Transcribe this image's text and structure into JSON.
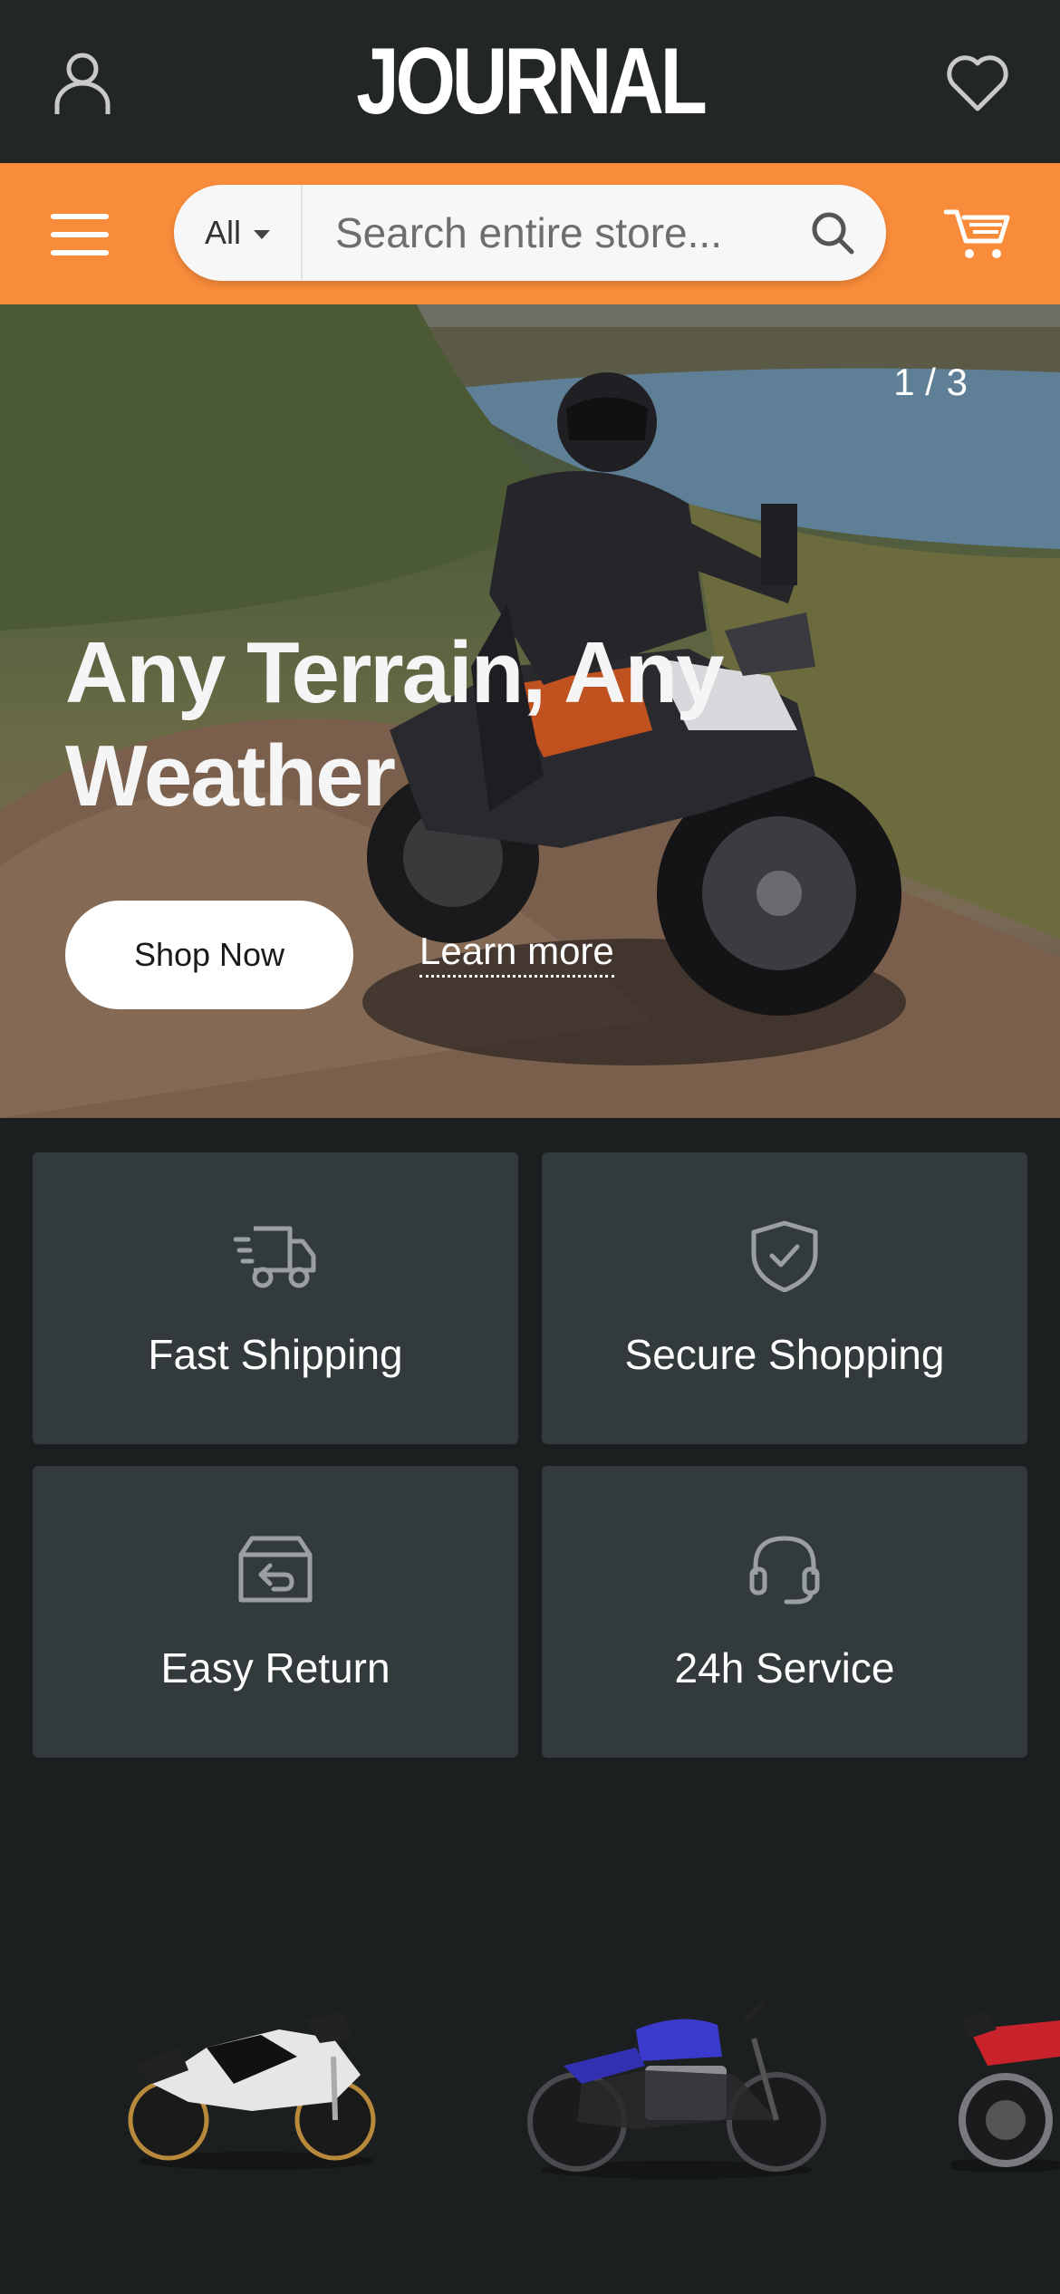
{
  "header": {
    "logo": "JOURNAL",
    "account_icon": "user-icon",
    "wishlist_icon": "heart-icon"
  },
  "search": {
    "category": "All",
    "placeholder": "Search entire store...",
    "menu_icon": "hamburger-icon",
    "search_icon": "search-icon",
    "cart_icon": "cart-icon"
  },
  "hero": {
    "counter": "1 / 3",
    "title": "Any Terrain, Any Weather",
    "primary_cta": "Shop Now",
    "secondary_cta": "Learn more"
  },
  "features": [
    {
      "label": "Fast Shipping",
      "icon": "truck-icon"
    },
    {
      "label": "Secure Shopping",
      "icon": "shield-check-icon"
    },
    {
      "label": "Easy Return",
      "icon": "return-box-icon"
    },
    {
      "label": "24h Service",
      "icon": "headset-icon"
    }
  ],
  "colors": {
    "accent": "#f98c3a",
    "header_bg": "#222627",
    "page_bg": "#1c1f20",
    "card_bg": "#323a3c"
  }
}
